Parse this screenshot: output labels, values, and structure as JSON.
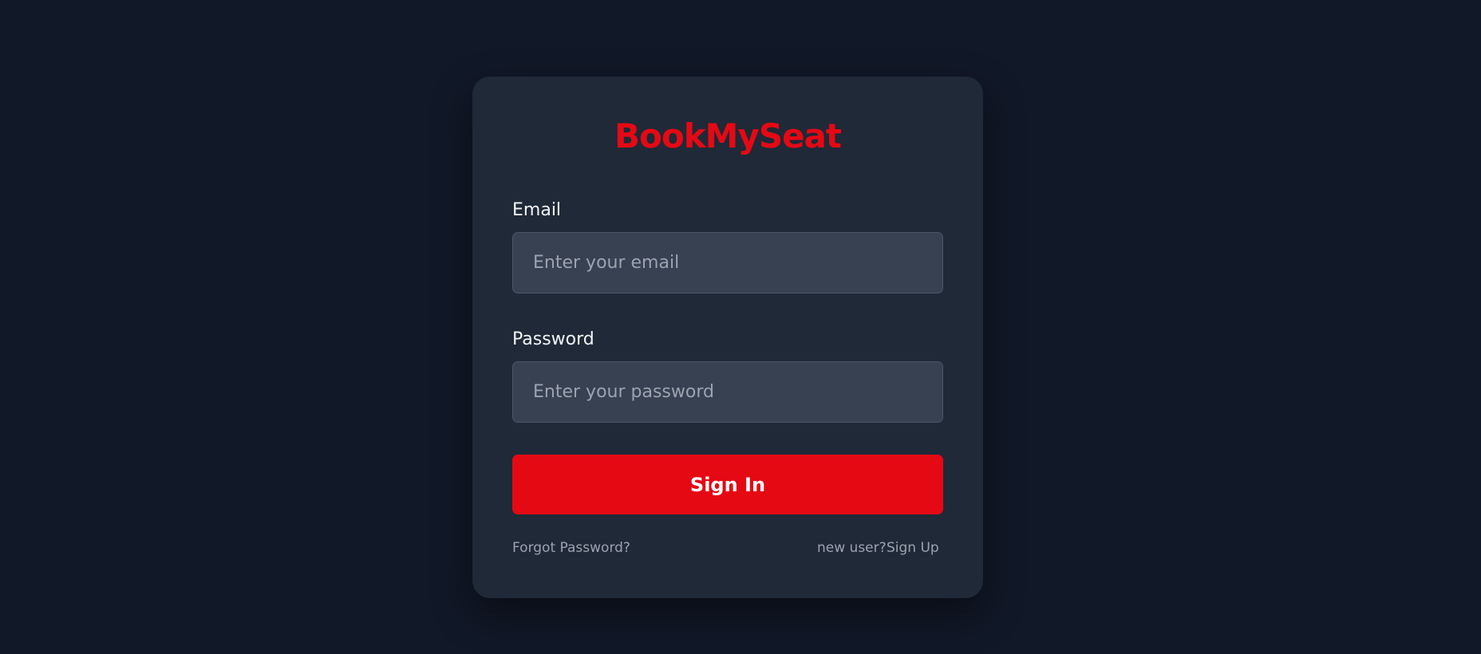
{
  "brand": {
    "name": "BookMySeat",
    "color": "#e50914"
  },
  "form": {
    "email_label": "Email",
    "email_placeholder": "Enter your email",
    "email_value": "",
    "password_label": "Password",
    "password_placeholder": "Enter your password",
    "password_value": "",
    "submit_label": "Sign In"
  },
  "footer": {
    "forgot_label": "Forgot Password?",
    "new_user_text": "new user?",
    "signup_label": "Sign Up"
  },
  "colors": {
    "background": "#111827",
    "card": "#1f2937",
    "input": "#374151",
    "accent": "#e50914"
  }
}
